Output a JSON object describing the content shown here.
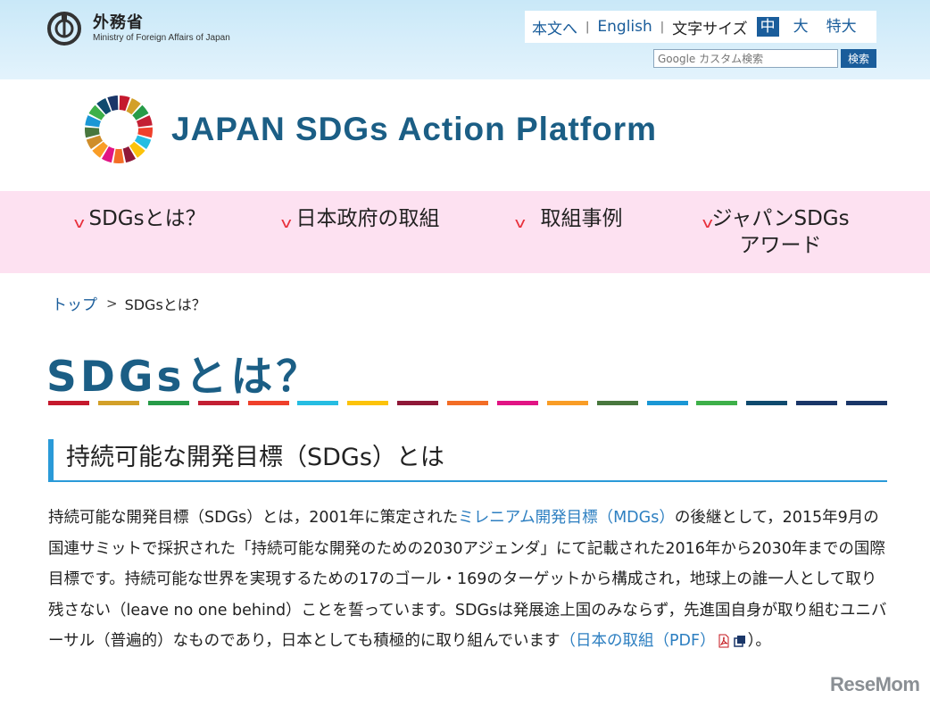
{
  "ministry": {
    "name_jp": "外務省",
    "name_en": "Ministry of Foreign Affairs of Japan"
  },
  "utility": {
    "main_text_link": "本文へ",
    "english_link": "English",
    "font_size_label": "文字サイズ",
    "sizes": [
      "中",
      "大",
      "特大"
    ],
    "active_size": "中"
  },
  "search": {
    "placeholder": "Google カスタム検索",
    "button_label": "検索"
  },
  "platform": {
    "title": "JAPAN SDGs Action Platform"
  },
  "nav": {
    "items": [
      {
        "label": "SDGsとは？"
      },
      {
        "label": "日本政府の取組"
      },
      {
        "label": "取組事例"
      },
      {
        "label_line1": "ジャパンSDGs",
        "label_line2": "アワード"
      }
    ]
  },
  "breadcrumb": {
    "top": "トップ",
    "current": "SDGsとは？"
  },
  "page": {
    "title": "SDGsとは？",
    "section_heading": "持続可能な開発目標（SDGs）とは",
    "body_1": "持続可能な開発目標（SDGs）とは，2001年に策定された",
    "mdgs_link": "ミレニアム開発目標（MDGs）",
    "body_2": "の後継として，2015年9月の国連サミットで採択された「持続可能な開発のための2030アジェンダ」にて記載された2016年から2030年までの国際目標です。持続可能な世界を実現するための17のゴール・169のターゲットから構成され，地球上の誰一人として取り残さない（leave no one behind）ことを誓っています。SDGsは発展途上国のみならず，先進国自身が取り組むユニバーサル（普遍的）なものであり，日本としても積極的に取り組んでいます",
    "pdf_link": "（日本の取組（PDF）",
    "body_end": "）。"
  },
  "colors": {
    "accent": "#1b5e85",
    "link": "#2d7fc1",
    "nav_bg": "#fde1f1",
    "sdg_bar": [
      "#c5192d",
      "#d3a029",
      "#279b48",
      "#c31f33",
      "#ef402b",
      "#26bde2",
      "#fcc30b",
      "#8f1838",
      "#f36d25",
      "#e11484",
      "#f99d26",
      "#cf8d2a",
      "#48773e",
      "#1a97d5",
      "#3eb049",
      "#0f4a6e",
      "#1a3668"
    ]
  },
  "watermark": "ReseMom"
}
